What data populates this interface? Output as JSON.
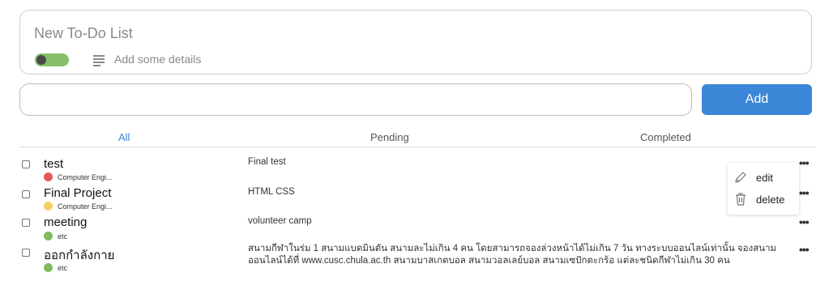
{
  "new_list": {
    "title": "New To-Do List",
    "details_label": "Add some details"
  },
  "input": {
    "value": "",
    "placeholder": ""
  },
  "add_button": {
    "label": "Add",
    "color": "#3b86d6"
  },
  "tabs": [
    {
      "label": "All",
      "active": true
    },
    {
      "label": "Pending",
      "active": false
    },
    {
      "label": "Completed",
      "active": false
    }
  ],
  "items": [
    {
      "title": "test",
      "tag": "Computer Engi...",
      "tag_color": "#e05a5a",
      "description": "Final test"
    },
    {
      "title": "Final Project",
      "tag": "Computer Engi...",
      "tag_color": "#f5cf63",
      "description": "HTML CSS"
    },
    {
      "title": "meeting",
      "tag": "etc",
      "tag_color": "#7dbd5c",
      "description": "volunteer camp"
    },
    {
      "title": "ออกกำลังกาย",
      "tag": "etc",
      "tag_color": "#7dbd5c",
      "description": "สนามกีฬาในร่ม 1 สนามแบดมินตัน สนามละไม่เกิน 4 คน โดยสามารถจองล่วงหน้าได้ไม่เกิน 7 วัน ทางระบบออนไลน์เท่านั้น จองสนามออนไลน์ได้ที่ www.cusc.chula.ac.th สนามบาสเกตบอล สนามวอลเลย์บอล สนามเซปักตะกร้อ แต่ละชนิดกีฬาไม่เกิน 30 คน"
    }
  ],
  "context_menu": {
    "edit_label": "edit",
    "delete_label": "delete"
  },
  "more_glyph": "•••"
}
